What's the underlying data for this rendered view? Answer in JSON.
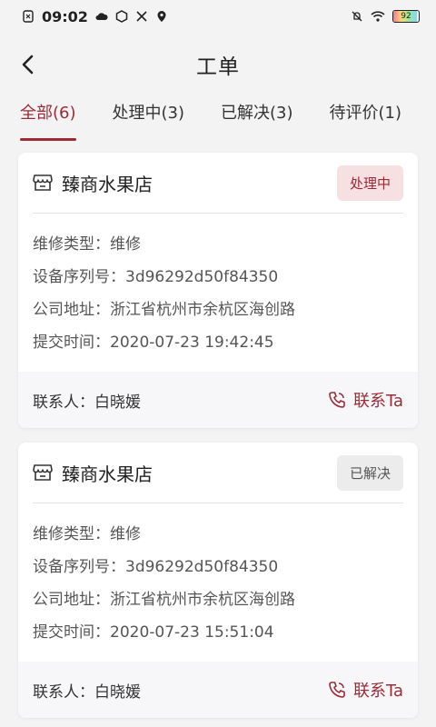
{
  "status_bar": {
    "time": "09:02",
    "battery": "92",
    "battery_level": 0.92
  },
  "header": {
    "title": "工单"
  },
  "tabs": [
    {
      "label": "全部(6)",
      "active": true
    },
    {
      "label": "处理中(3)",
      "active": false
    },
    {
      "label": "已解决(3)",
      "active": false
    },
    {
      "label": "待评价(1)",
      "active": false
    }
  ],
  "orders": [
    {
      "shop": "臻商水果店",
      "status": "处理中",
      "status_type": "processing",
      "fields": [
        {
          "label": "维修类型：",
          "value": "维修"
        },
        {
          "label": "设备序列号：",
          "value": "3d96292d50f84350"
        },
        {
          "label": "公司地址：",
          "value": "浙江省杭州市余杭区海创路"
        },
        {
          "label": "提交时间：",
          "value": "2020-07-23 19:42:45"
        }
      ],
      "contact_label": "联系人：",
      "contact_name": "白晓媛",
      "contact_button": "联系Ta"
    },
    {
      "shop": "臻商水果店",
      "status": "已解决",
      "status_type": "resolved",
      "fields": [
        {
          "label": "维修类型：",
          "value": "维修"
        },
        {
          "label": "设备序列号：",
          "value": "3d96292d50f84350"
        },
        {
          "label": "公司地址：",
          "value": "浙江省杭州市余杭区海创路"
        },
        {
          "label": "提交时间：",
          "value": "2020-07-23 15:51:04"
        }
      ],
      "contact_label": "联系人：",
      "contact_name": "白晓媛",
      "contact_button": "联系Ta"
    }
  ],
  "colors": {
    "accent": "#9c2b37",
    "background": "#f3f3f4"
  }
}
